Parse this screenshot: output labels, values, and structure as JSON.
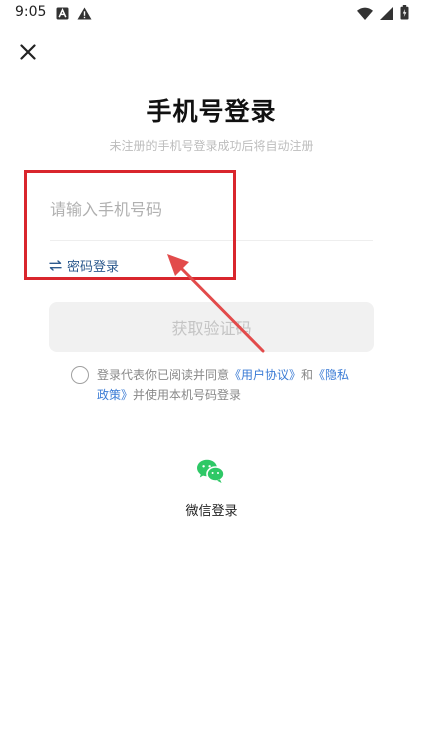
{
  "status_bar": {
    "time": "9:05",
    "left_icons": [
      "a-box-icon",
      "warning-icon"
    ],
    "right_icons": [
      "wifi-icon",
      "cellular-icon",
      "battery-icon"
    ]
  },
  "header": {
    "close_icon": "close-icon"
  },
  "main": {
    "title": "手机号登录",
    "subtitle": "未注册的手机号登录成功后将自动注册",
    "phone_input": {
      "value": "",
      "placeholder": "请输入手机号码"
    },
    "password_login": {
      "icon": "swap-arrows-icon",
      "label": "密码登录"
    },
    "get_code_button": "获取验证码",
    "agreement": {
      "prefix": "登录代表你已阅读并同意",
      "user_agreement": "《用户协议》",
      "and": "和",
      "privacy_policy": "《隐私政策》",
      "suffix": "并使用本机号码登录"
    },
    "wechat_login": {
      "icon": "wechat-icon",
      "label": "微信登录"
    }
  },
  "colors": {
    "link": "#3a7bd5",
    "password_link": "#2d5a8e",
    "annotation": "#d9262d",
    "wechat_green": "#2ec866",
    "disabled_button_bg": "#f1f1f1"
  }
}
